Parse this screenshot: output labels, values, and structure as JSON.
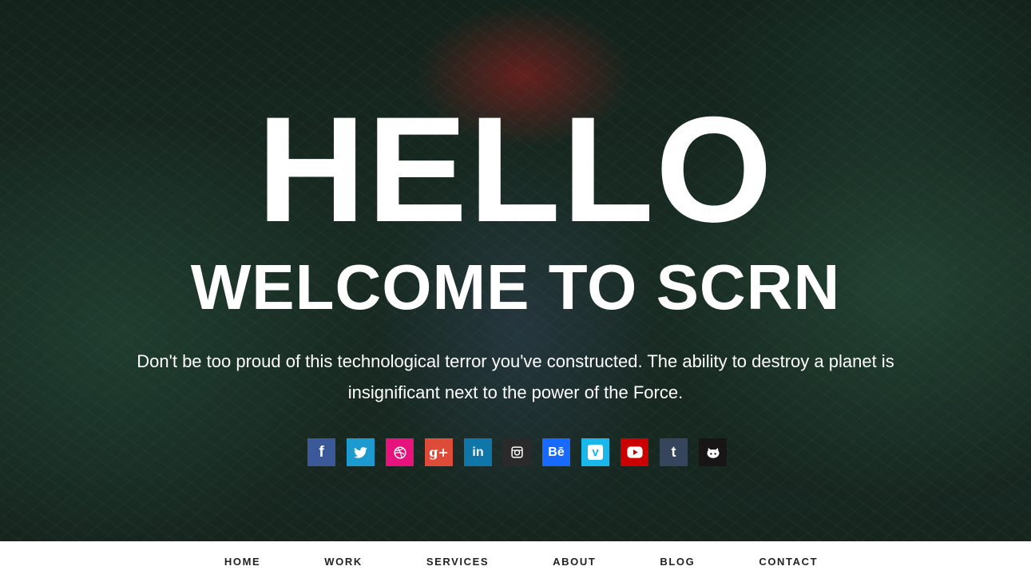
{
  "hero": {
    "headline": "HELLO",
    "subheadline": "WELCOME TO SCRN",
    "tagline": "Don't be too proud of this technological terror you've constructed. The ability to destroy a planet is insignificant next to the power of the Force."
  },
  "social": [
    {
      "icon": "facebook-icon",
      "glyph": "f",
      "color": "#3b5998"
    },
    {
      "icon": "twitter-icon",
      "glyph": "",
      "color": "#1da1f2"
    },
    {
      "icon": "dribbble-icon",
      "glyph": "",
      "color": "#ea4c89"
    },
    {
      "icon": "google-plus-icon",
      "glyph": "g+",
      "color": "#dd4b39"
    },
    {
      "icon": "linkedin-icon",
      "glyph": "in",
      "color": "#0077b5"
    },
    {
      "icon": "instagram-icon",
      "glyph": "",
      "color": "#262626"
    },
    {
      "icon": "behance-icon",
      "glyph": "Bē",
      "color": "#1769ff"
    },
    {
      "icon": "vimeo-icon",
      "glyph": "v",
      "color": "#1ab7ea"
    },
    {
      "icon": "youtube-icon",
      "glyph": "",
      "color": "#cc0000"
    },
    {
      "icon": "tumblr-icon",
      "glyph": "t",
      "color": "#35465c"
    },
    {
      "icon": "github-icon",
      "glyph": "",
      "color": "#171515"
    }
  ],
  "nav": {
    "items": [
      "HOME",
      "WORK",
      "SERVICES",
      "ABOUT",
      "BLOG",
      "CONTACT"
    ]
  }
}
